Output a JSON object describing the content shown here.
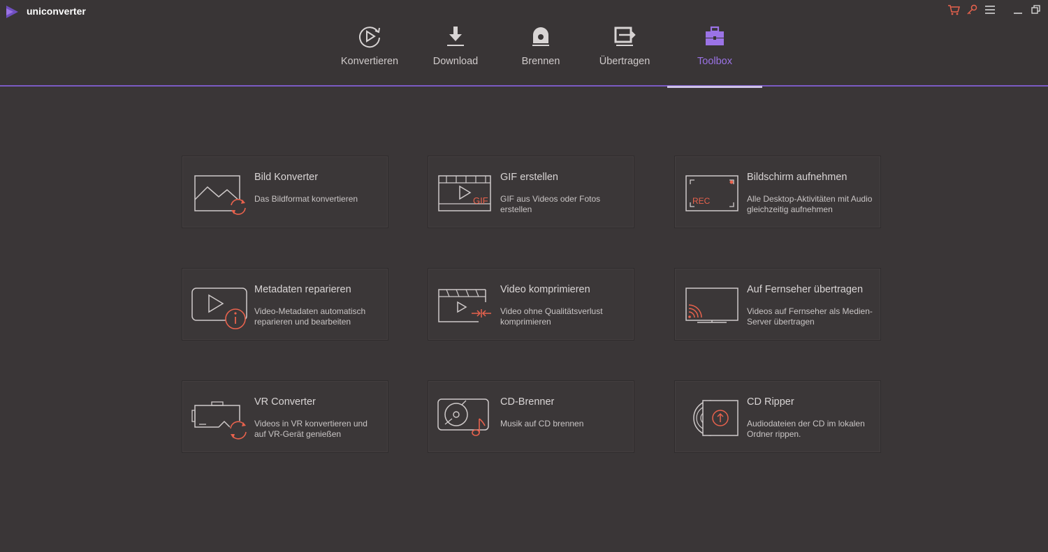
{
  "app": {
    "title": "uniconverter"
  },
  "colors": {
    "accent": "#9b73e6",
    "icon_line": "#cfcaca",
    "icon_accent": "#e8624d"
  },
  "nav": {
    "tabs": [
      {
        "label": "Konvertieren",
        "icon": "convert-icon"
      },
      {
        "label": "Download",
        "icon": "download-icon"
      },
      {
        "label": "Brennen",
        "icon": "burn-disc-icon"
      },
      {
        "label": "Übertragen",
        "icon": "transfer-icon"
      },
      {
        "label": "Toolbox",
        "icon": "toolbox-icon",
        "active": true
      }
    ]
  },
  "tools": [
    {
      "title": "Bild Konverter",
      "desc": "Das Bildformat konvertieren",
      "icon": "image-convert-icon"
    },
    {
      "title": "GIF erstellen",
      "desc": "GIF aus Videos oder Fotos erstellen",
      "icon": "gif-maker-icon",
      "badge": "GIF"
    },
    {
      "title": "Bildschirm aufnehmen",
      "desc": "Alle Desktop-Aktivitäten mit Audio gleichzeitig aufnehmen",
      "icon": "screen-record-icon",
      "badge": "REC"
    },
    {
      "title": "Metadaten reparieren",
      "desc": "Video-Metadaten automatisch reparieren und bearbeiten",
      "icon": "metadata-fix-icon"
    },
    {
      "title": "Video komprimieren",
      "desc": "Video ohne Qualitätsverlust komprimieren",
      "icon": "video-compress-icon"
    },
    {
      "title": "Auf Fernseher übertragen",
      "desc": "Videos auf Fernseher als Medien-Server übertragen",
      "icon": "cast-tv-icon"
    },
    {
      "title": "VR Converter",
      "desc": "Videos in VR konvertieren und auf VR-Gerät genießen",
      "icon": "vr-convert-icon"
    },
    {
      "title": "CD-Brenner",
      "desc": "Musik auf CD brennen",
      "icon": "cd-burner-icon"
    },
    {
      "title": "CD Ripper",
      "desc": "Audiodateien der CD im lokalen Ordner rippen.",
      "icon": "cd-ripper-icon"
    }
  ]
}
